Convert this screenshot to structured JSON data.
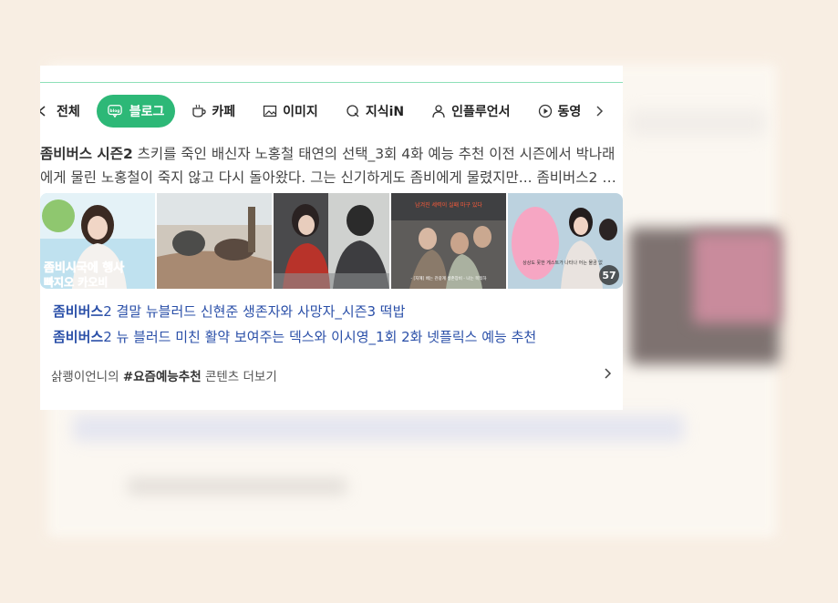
{
  "tabs": {
    "all": "전체",
    "blog": "블로그",
    "cafe": "카페",
    "image": "이미지",
    "kin": "지식iN",
    "influencer": "인플루언서",
    "video": "동영"
  },
  "blog_icon_text": "blog",
  "result": {
    "title_kw": "좀비버스 시즌2",
    "snippet": " 츠키를 죽인 배신자 노홍철 태연의 선택_3회 4화 예능 추천 이전 시즌에서 박나래에게 물린 노홍철이 죽지 않고 다시 돌아왔다. 그는 신기하게도 좀비에게 물렸지만... 좀비버스2 …"
  },
  "thumbnails": {
    "t1_caption_line1": "좀비시국에 행사",
    "t1_caption_line2": "빠지오 카오비",
    "t4_caption_top": "남겨진 세력이 실패 마구 있다",
    "t4_caption_bottom": "- [지혜] 배는 관광계 생존장비 - 나는 목적하",
    "t5_caption": "상상도 못한 게스트가 나타나 어는 물곰 없",
    "count": "57"
  },
  "related_links": [
    {
      "kw": "좀비버스",
      "rest": "2 결말 뉴블러드 신현준 생존자와 사망자_시즌3 떡밥"
    },
    {
      "kw": "좀비버스",
      "rest": "2 뉴 블러드 미친 활약 보여주는 덱스와 이시영_1회 2화 넷플릭스 예능 추천"
    }
  ],
  "more": {
    "prefix": "삵쾡이언니의 ",
    "tag": "#요즘예능추천",
    "suffix": " 콘텐츠 더보기"
  },
  "colors": {
    "accent_green": "#2db877",
    "link_blue": "#2a4fa8",
    "page_bg": "#f8eee3"
  }
}
